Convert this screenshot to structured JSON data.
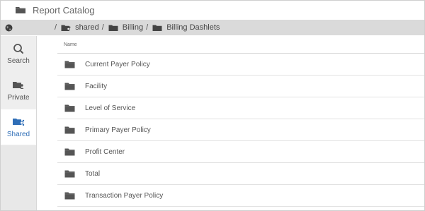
{
  "window": {
    "title": "Report Catalog",
    "title_icon": "folder-icon"
  },
  "breadcrumb": {
    "globe_icon": "globe-icon",
    "items": [
      {
        "label": "shared",
        "icon": "shared-folder-icon"
      },
      {
        "label": "Billing",
        "icon": "folder-icon"
      },
      {
        "label": "Billing Dashlets",
        "icon": "folder-icon"
      }
    ],
    "separator": "/"
  },
  "sidebar": {
    "items": [
      {
        "label": "Search",
        "icon": "search-icon",
        "active": false
      },
      {
        "label": "Private",
        "icon": "private-folder-icon",
        "active": false
      },
      {
        "label": "Shared",
        "icon": "shared-folder-icon",
        "active": true
      }
    ]
  },
  "table": {
    "header": "Name",
    "rows": [
      {
        "label": "Current Payer Policy",
        "icon": "folder-icon"
      },
      {
        "label": "Facility",
        "icon": "folder-icon"
      },
      {
        "label": "Level of Service",
        "icon": "folder-icon"
      },
      {
        "label": "Primary Payer Policy",
        "icon": "folder-icon"
      },
      {
        "label": "Profit Center",
        "icon": "folder-icon"
      },
      {
        "label": "Total",
        "icon": "folder-icon"
      },
      {
        "label": "Transaction Payer Policy",
        "icon": "folder-icon"
      }
    ]
  },
  "colors": {
    "accent": "#2f6eb7",
    "icon_gray": "#555555",
    "breadcrumb_bg": "#dadada",
    "sidebar_bg": "#eeeeee"
  }
}
